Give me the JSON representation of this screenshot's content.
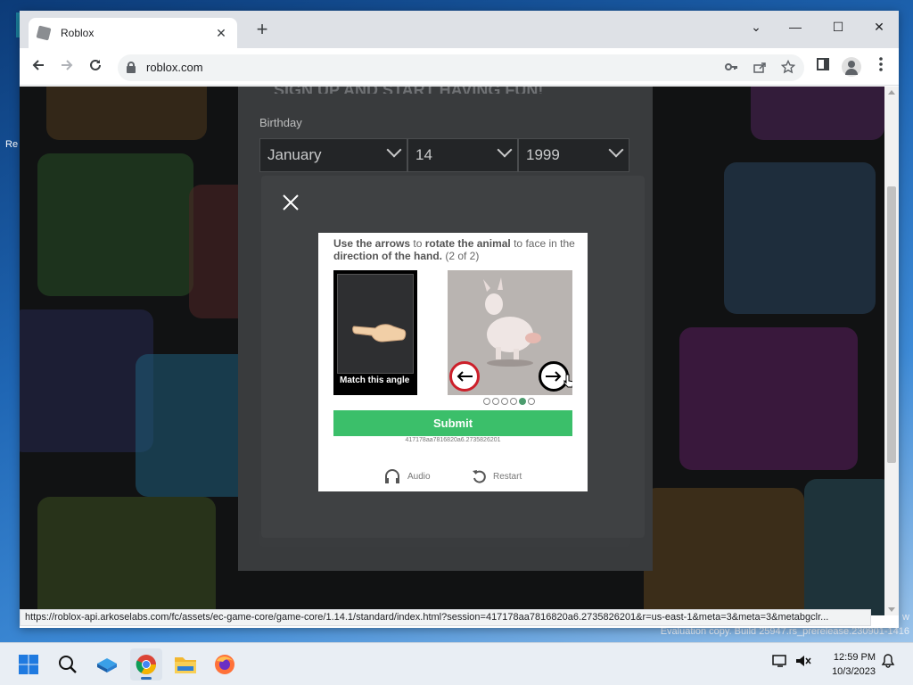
{
  "browser": {
    "tab_title": "Roblox",
    "tab_close": "✕",
    "new_tab": "+",
    "url": "roblox.com",
    "window_controls": {
      "minimize": "—",
      "maximize": "☐",
      "close": "✕",
      "tab_search": "⌄"
    },
    "status_url": "https://roblox-api.arkoselabs.com/fc/assets/ec-game-core/game-core/1.14.1/standard/index.html?session=417178aa7816820a6.2735826201&r=us-east-1&meta=3&meta=3&metabgclr..."
  },
  "desktop": {
    "left_fragment": "Re",
    "eval_fragment": "w",
    "evaluation_text": "Evaluation copy. Build 25947.rs_prerelease.230901-1416"
  },
  "signup": {
    "heading_fragment": "SIGN UP AND START HAVING FUN!",
    "birthday_label": "Birthday",
    "month": "January",
    "day": "14",
    "year": "1999"
  },
  "captcha": {
    "instruction_part1": "Use the arrows",
    "instruction_part2": " to ",
    "instruction_part3": "rotate the animal",
    "instruction_part4": " to face in the ",
    "instruction_part5": "direction of the hand.",
    "instruction_part6": " (2 of 2)",
    "reference_caption": "Match this angle",
    "dots": 6,
    "active_dot": 5,
    "submit_label": "Submit",
    "session_id": "417178aa7816820a6.2735826201",
    "audio_label": "Audio",
    "restart_label": "Restart"
  },
  "taskbar": {
    "time": "12:59 PM",
    "date": "10/3/2023"
  },
  "colors": {
    "submit_green": "#3bbf6a",
    "active_dot": "#4c9c6e",
    "left_arrow_ring": "#cc1f2a"
  }
}
